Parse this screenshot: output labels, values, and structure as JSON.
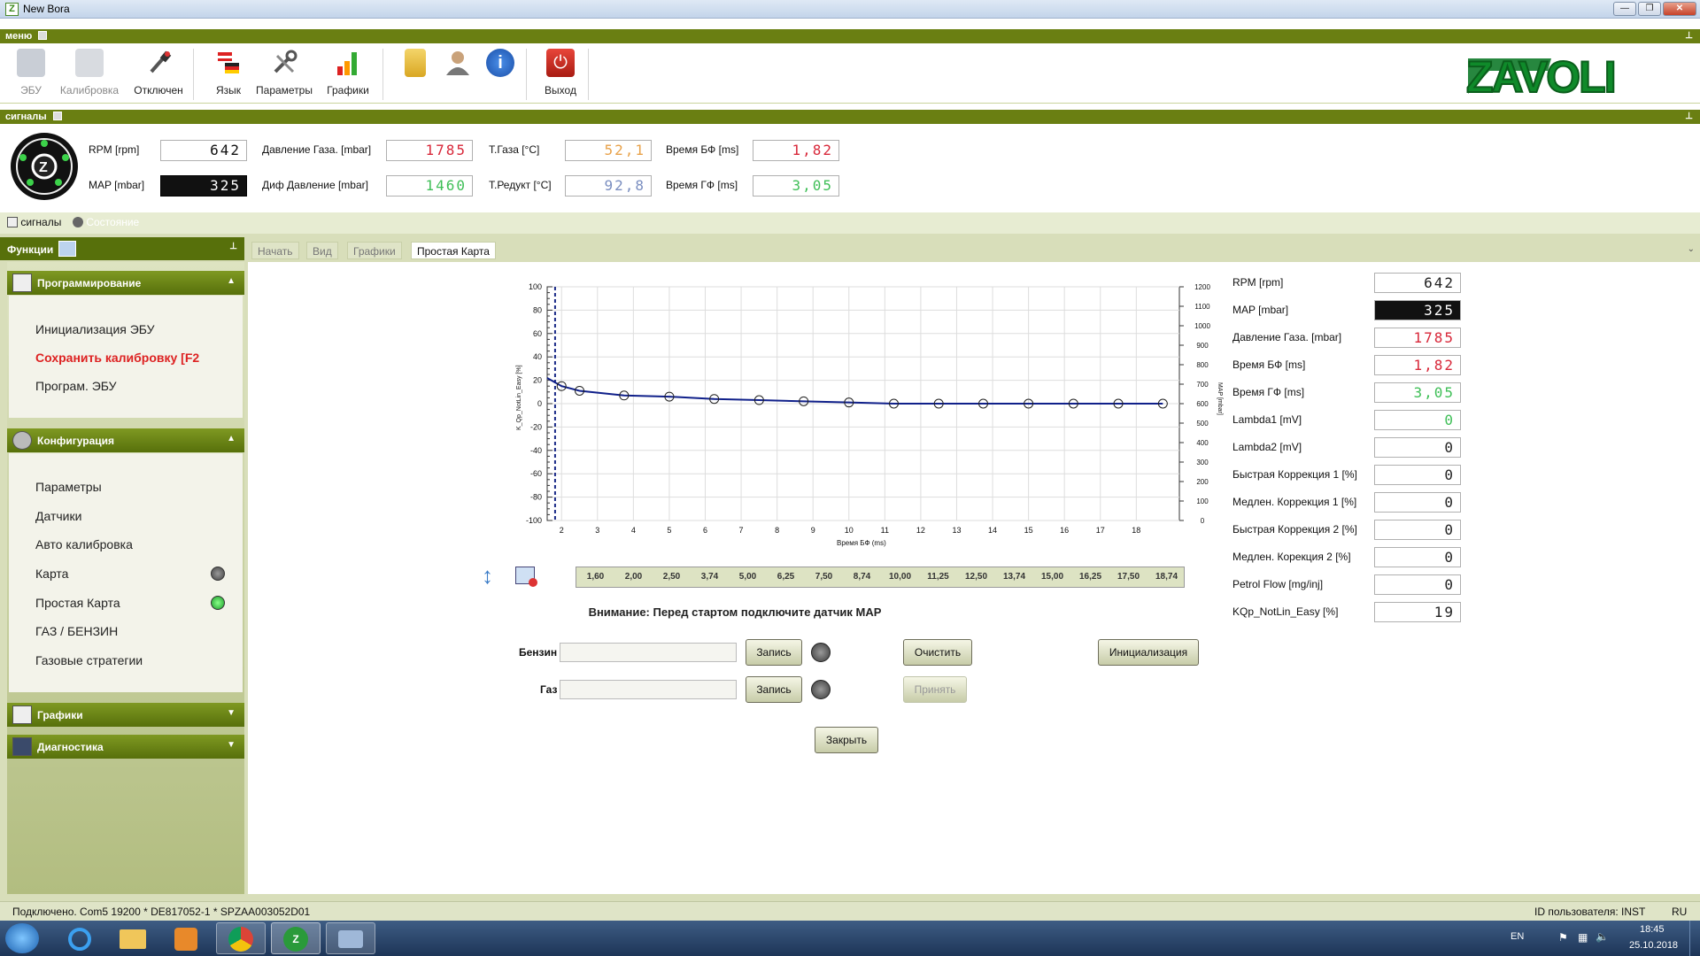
{
  "window": {
    "title": "New Bora"
  },
  "menu_header": "меню",
  "ribbon": {
    "items": [
      "ЭБУ",
      "Калибровка",
      "Отключен",
      "Язык",
      "Параметры",
      "Графики",
      "Выход"
    ]
  },
  "logo_text": "ZAVOLI",
  "signals_header": "сигналы",
  "signals": {
    "rpm_label": "RPM [rpm]",
    "rpm": "642",
    "map_label": "MAP [mbar]",
    "map": "325",
    "gas_pressure_label": "Давление Газа. [mbar]",
    "gas_pressure": "1785",
    "diff_pressure_label": "Диф Давление [mbar]",
    "diff_pressure": "1460",
    "t_gas_label": "Т.Газа [°C]",
    "t_gas": "52,1",
    "t_reduct_label": "Т.Редукт [°C]",
    "t_reduct": "92,8",
    "time_bf_label": "Время БФ [ms]",
    "time_bf": "1,82",
    "time_gf_label": "Время ГФ [ms]",
    "time_gf": "3,05"
  },
  "bottom_tabs": [
    "сигналы",
    "Состояние"
  ],
  "functions_header": "Функции",
  "left": {
    "programming": {
      "title": "Программирование",
      "items": [
        "Инициализация ЭБУ",
        "Сохранить калибровку [F2",
        "Програм. ЭБУ"
      ]
    },
    "config": {
      "title": "Конфигурация",
      "items": [
        "Параметры",
        "Датчики",
        "Авто калибровка",
        "Карта",
        "Простая Карта",
        "ГАЗ / БЕНЗИН",
        "Газовые стратегии"
      ]
    },
    "graphs": {
      "title": "Графики"
    },
    "diagnostics": {
      "title": "Диагностика"
    }
  },
  "content_tabs": [
    "Начать",
    "Вид",
    "Графики",
    "Простая Карта"
  ],
  "chart_data": {
    "type": "line",
    "xlabel": "Время БФ (ms)",
    "ylabel": "K_Qp_NotLin_Easy [%]",
    "y2label": "MAP [mbar]",
    "xlim": [
      1.6,
      19.2
    ],
    "ylim": [
      -100,
      100
    ],
    "y2lim": [
      0,
      1200
    ],
    "xticks": [
      "2",
      "3",
      "4",
      "5",
      "6",
      "7",
      "8",
      "9",
      "10",
      "11",
      "12",
      "13",
      "14",
      "15",
      "16",
      "17",
      "18"
    ],
    "yticks": [
      "100",
      "80",
      "60",
      "40",
      "20",
      "0",
      "-20",
      "-40",
      "-60",
      "-80",
      "-100"
    ],
    "y2ticks": [
      "1200",
      "1100",
      "1000",
      "900",
      "800",
      "700",
      "600",
      "500",
      "400",
      "300",
      "200",
      "100",
      "0"
    ],
    "cursor_x": 1.82,
    "series": [
      {
        "x": [
          1.6,
          2.0,
          2.5,
          3.74,
          5.0,
          6.25,
          7.5,
          8.74,
          10.0,
          11.25,
          12.5,
          13.74,
          15.0,
          16.25,
          17.5,
          18.74
        ],
        "values": [
          22,
          15,
          11,
          7,
          6,
          4,
          3,
          2,
          1,
          0,
          0,
          0,
          0,
          0,
          0,
          0
        ]
      }
    ]
  },
  "map_points": [
    "1,60",
    "2,00",
    "2,50",
    "3,74",
    "5,00",
    "6,25",
    "7,50",
    "8,74",
    "10,00",
    "11,25",
    "12,50",
    "13,74",
    "15,00",
    "16,25",
    "17,50",
    "18,74"
  ],
  "warning": "Внимание: Перед стартом подключите датчик MAP",
  "controls": {
    "petrol_label": "Бензин",
    "gas_label": "Газ",
    "write": "Запись",
    "clear": "Очистить",
    "accept": "Принять",
    "init": "Инициализация",
    "close": "Закрыть"
  },
  "right_values": [
    {
      "label": "RPM [rpm]",
      "value": "642",
      "color": "#222222",
      "dark": false
    },
    {
      "label": "MAP [mbar]",
      "value": "325",
      "color": "#ffffff",
      "dark": true
    },
    {
      "label": "Давление Газа. [mbar]",
      "value": "1785",
      "color": "#d8283a",
      "dark": false
    },
    {
      "label": "Время БФ [ms]",
      "value": "1,82",
      "color": "#d8283a",
      "dark": false
    },
    {
      "label": "Время ГФ [ms]",
      "value": "3,05",
      "color": "#3fbf57",
      "dark": false
    },
    {
      "label": "Lambda1 [mV]",
      "value": "0",
      "color": "#3fbf57",
      "dark": false
    },
    {
      "label": "Lambda2 [mV]",
      "value": "0",
      "color": "#222222",
      "dark": false
    },
    {
      "label": "Быстрая Коррекция 1 [%]",
      "value": "0",
      "color": "#222222",
      "dark": false
    },
    {
      "label": "Медлен. Коррекция 1 [%]",
      "value": "0",
      "color": "#222222",
      "dark": false
    },
    {
      "label": "Быстрая Коррекция 2 [%]",
      "value": "0",
      "color": "#222222",
      "dark": false
    },
    {
      "label": "Медлен. Корекция 2 [%]",
      "value": "0",
      "color": "#222222",
      "dark": false
    },
    {
      "label": "Petrol Flow [mg/inj]",
      "value": "0",
      "color": "#222222",
      "dark": false
    },
    {
      "label": "KQp_NotLin_Easy [%]",
      "value": "19",
      "color": "#222222",
      "dark": false
    }
  ],
  "status": {
    "left": "Подключено. Com5 19200 * DE817052-1 * SPZAA003052D01",
    "user": "ID пользователя: INST",
    "lang": "RU"
  },
  "taskbar": {
    "lang": "EN",
    "time": "18:45",
    "date": "25.10.2018"
  }
}
